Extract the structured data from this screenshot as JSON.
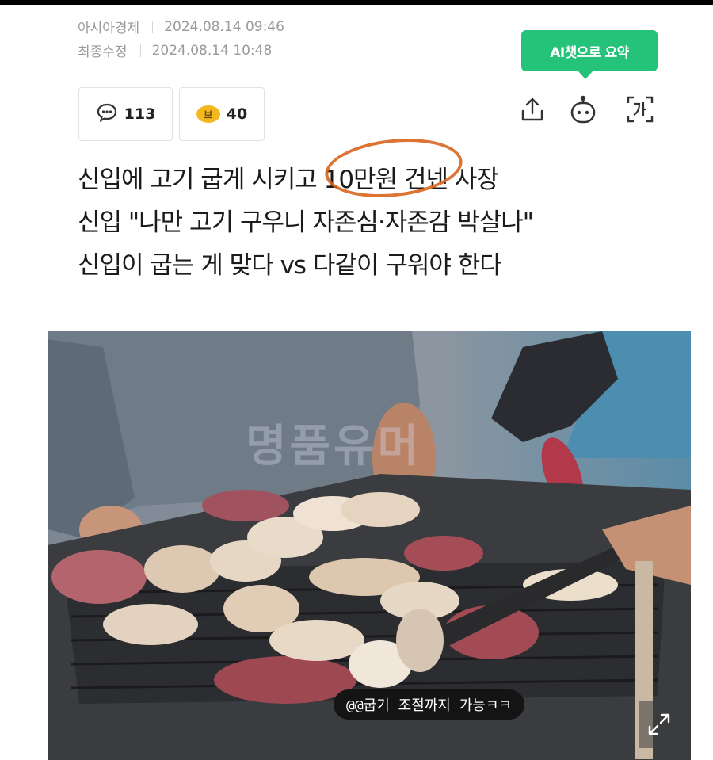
{
  "meta": {
    "source": "아시아경제",
    "published": "2024.08.14 09:46",
    "modified_label": "최종수정",
    "modified": "2024.08.14 10:48"
  },
  "ai_summary": {
    "label": "AI챗으로 요약"
  },
  "reactions": {
    "comment_count": "113",
    "bonus_badge": "보",
    "bonus_count": "40"
  },
  "icons": {
    "comment": "comment-bubble-icon",
    "share": "share-icon",
    "bot": "ai-bot-icon",
    "translate": "translate-icon",
    "expand": "expand-icon"
  },
  "headline": {
    "line1": "신입에 고기 굽게 시키고 10만원 건넨 사장",
    "line2": "신입 \"나만 고기 구우니 자존심·자존감 박살나\"",
    "line3": "신입이 굽는 게 맞다 vs 다같이 구워야 한다"
  },
  "photo": {
    "watermark": "명품유머",
    "caption": "@@굽기 조절까지 가능ㅋㅋ"
  },
  "colors": {
    "accent_green": "#25c37a",
    "annotation_orange": "#d9651d",
    "meta_gray": "#9a9a9a"
  }
}
